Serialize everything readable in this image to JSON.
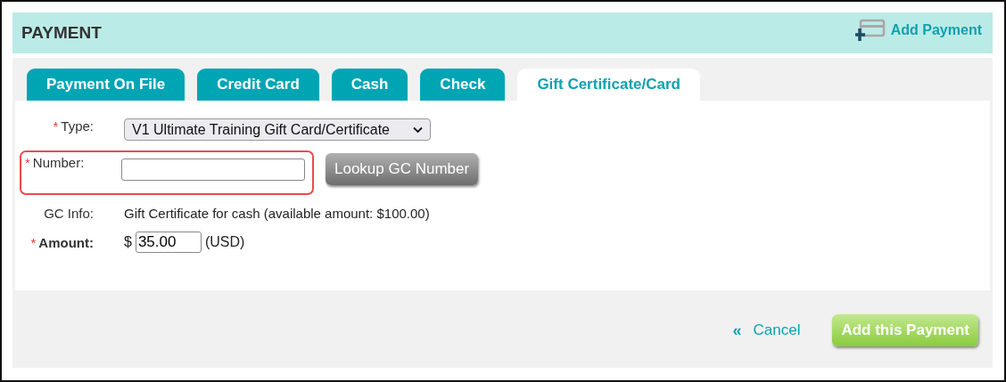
{
  "header": {
    "title": "PAYMENT",
    "action": "Add Payment"
  },
  "tabs": [
    {
      "label": "Payment On File",
      "selected": false
    },
    {
      "label": "Credit Card",
      "selected": false
    },
    {
      "label": "Cash",
      "selected": false
    },
    {
      "label": "Check",
      "selected": false
    },
    {
      "label": "Gift Certificate/Card",
      "selected": true
    }
  ],
  "fields": [
    {
      "kind": "select",
      "required_mark": "*",
      "label": "Type:",
      "bold": false,
      "highlighted": false,
      "value": "V1 Ultimate Training Gift Card/Certificate"
    },
    {
      "kind": "lookup",
      "required_mark": "*",
      "label": "Number:",
      "bold": false,
      "highlighted": true,
      "button": "Lookup GC Number"
    },
    {
      "kind": "info",
      "label": "GC Info:",
      "bold": false,
      "highlighted": false,
      "value": "Gift Certificate for cash (available amount: $100.00)"
    },
    {
      "kind": "amount",
      "required_mark": "*",
      "label": "Amount:",
      "bold": true,
      "highlighted": false,
      "prefix": "$",
      "value": "35.00",
      "suffix": "(USD)"
    }
  ],
  "footer": {
    "cancel_icon": "«",
    "cancel": "Cancel",
    "submit": "Add this Payment"
  }
}
